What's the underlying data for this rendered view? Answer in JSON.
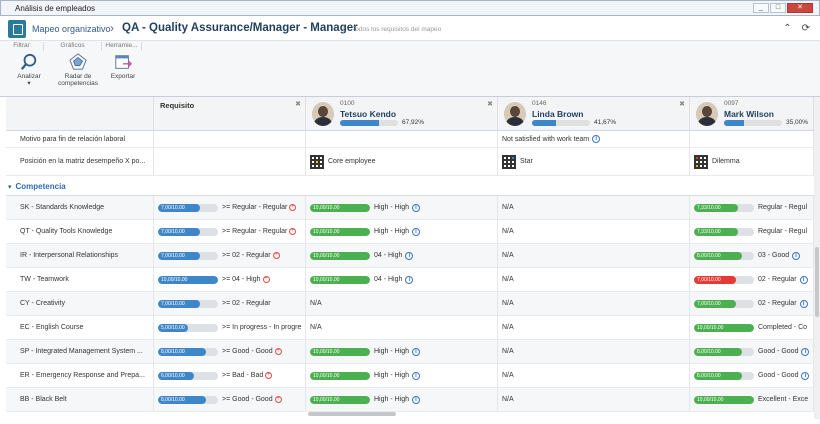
{
  "window": {
    "title": "Análisis de empleados",
    "buttons": [
      "_",
      "□",
      "✕"
    ]
  },
  "header": {
    "breadcrumb_root": "Mapeo organizativo",
    "separator": "›",
    "title": "QA - Quality Assurance/Manager - Manager",
    "subtitle": "Todos los requisitos del mapeo"
  },
  "ribbon": {
    "tabs": [
      "Filtrar",
      "Gráficos",
      "Herramie..."
    ],
    "buttons": [
      {
        "label": "Analizar",
        "icon": "analyze-icon",
        "dropdown": "▾"
      },
      {
        "label": "Radar de competencias",
        "icon": "radar-icon"
      },
      {
        "label": "Exportar",
        "icon": "export-icon"
      }
    ]
  },
  "columns": {
    "requirement": "Requisito",
    "employees": [
      {
        "code": "0100",
        "name": "Tetsuo Kendo",
        "progress": 67.92,
        "pct_label": "67,92%"
      },
      {
        "code": "0146",
        "name": "Linda Brown",
        "progress": 41.67,
        "pct_label": "41,67%"
      },
      {
        "code": "0097",
        "name": "Mark Wilson",
        "progress": 35.0,
        "pct_label": "35,00%"
      }
    ]
  },
  "info_rows": [
    {
      "label": "Motivo para fin de relación laboral",
      "values": [
        "",
        "Not satisfied with work team",
        ""
      ]
    },
    {
      "label": "Posición en la matriz desempeño X po...",
      "values": [
        "Core employee",
        "Star",
        "Dilemma"
      ]
    }
  ],
  "section": {
    "label": "Competencia",
    "caret": "▾"
  },
  "competencies": [
    {
      "label": "SK - Standards Knowledge",
      "req": {
        "bar": "7,00/10,00",
        "fill": 0.7,
        "text": ">= Regular - Regular",
        "plus": true
      },
      "emps": [
        {
          "bar": "10,00/10,00",
          "fill": 1.0,
          "color": "#4caf50",
          "text": "High - High",
          "info": true
        },
        {
          "text": "N/A"
        },
        {
          "bar": "7,33/10,00",
          "fill": 0.733,
          "color": "#4caf50",
          "text": "Regular - Regul"
        }
      ]
    },
    {
      "label": "QT - Quality Tools Knowledge",
      "req": {
        "bar": "7,00/10,00",
        "fill": 0.7,
        "text": ">= Regular - Regular",
        "plus": true
      },
      "emps": [
        {
          "bar": "10,00/10,00",
          "fill": 1.0,
          "color": "#4caf50",
          "text": "High - High",
          "info": true
        },
        {
          "text": "N/A"
        },
        {
          "bar": "7,33/10,00",
          "fill": 0.733,
          "color": "#4caf50",
          "text": "Regular - Regul"
        }
      ]
    },
    {
      "label": "IR - Interpersonal Relationships",
      "req": {
        "bar": "7,00/10,00",
        "fill": 0.7,
        "text": ">= 02 - Regular",
        "plus": true
      },
      "emps": [
        {
          "bar": "10,00/10,00",
          "fill": 1.0,
          "color": "#4caf50",
          "text": "04 - High",
          "info": true
        },
        {
          "text": "N/A"
        },
        {
          "bar": "8,00/10,00",
          "fill": 0.8,
          "color": "#4caf50",
          "text": "03 - Good",
          "info": true
        }
      ]
    },
    {
      "label": "TW - Teamwork",
      "req": {
        "bar": "10,00/10,00",
        "fill": 1.0,
        "text": ">= 04 - High",
        "plus": true
      },
      "emps": [
        {
          "bar": "10,00/10,00",
          "fill": 1.0,
          "color": "#4caf50",
          "text": "04 - High",
          "info": true
        },
        {
          "text": "N/A"
        },
        {
          "bar": "7,00/10,00",
          "fill": 0.7,
          "color": "#e53935",
          "text": "02 - Regular",
          "info": true
        }
      ]
    },
    {
      "label": "CY - Creativity",
      "req": {
        "bar": "7,00/10,00",
        "fill": 0.7,
        "text": ">= 02 - Regular",
        "plus": false
      },
      "emps": [
        {
          "text": "N/A"
        },
        {
          "text": "N/A"
        },
        {
          "bar": "7,00/10,00",
          "fill": 0.7,
          "color": "#4caf50",
          "text": "02 - Regular",
          "info": true
        }
      ]
    },
    {
      "label": "EC - English Course",
      "req": {
        "bar": "5,00/10,00",
        "fill": 0.5,
        "text": ">= In progress - In progre",
        "plus": false
      },
      "emps": [
        {
          "text": "N/A"
        },
        {
          "text": "N/A"
        },
        {
          "bar": "10,00/10,00",
          "fill": 1.0,
          "color": "#4caf50",
          "text": "Completed - Co"
        }
      ]
    },
    {
      "label": "SP - Integrated Management System ...",
      "req": {
        "bar": "8,00/10,00",
        "fill": 0.8,
        "text": ">= Good - Good",
        "plus": true
      },
      "emps": [
        {
          "bar": "10,00/10,00",
          "fill": 1.0,
          "color": "#4caf50",
          "text": "High - High",
          "info": true
        },
        {
          "text": "N/A"
        },
        {
          "bar": "8,00/10,00",
          "fill": 0.8,
          "color": "#4caf50",
          "text": "Good - Good",
          "info": true
        }
      ]
    },
    {
      "label": "ER - Emergency Response and Prepa...",
      "req": {
        "bar": "6,00/10,00",
        "fill": 0.6,
        "text": ">= Bad - Bad",
        "plus": true
      },
      "emps": [
        {
          "bar": "10,00/10,00",
          "fill": 1.0,
          "color": "#4caf50",
          "text": "High - High",
          "info": true
        },
        {
          "text": "N/A"
        },
        {
          "bar": "8,00/10,00",
          "fill": 0.8,
          "color": "#4caf50",
          "text": "Good - Good",
          "info": true
        }
      ]
    },
    {
      "label": "BB - Black Belt",
      "req": {
        "bar": "8,00/10,00",
        "fill": 0.8,
        "text": ">= Good - Good",
        "plus": true
      },
      "emps": [
        {
          "bar": "10,00/10,00",
          "fill": 1.0,
          "color": "#4caf50",
          "text": "High - High",
          "info": true
        },
        {
          "text": "N/A"
        },
        {
          "bar": "10,00/10,00",
          "fill": 1.0,
          "color": "#4caf50",
          "text": "Excellent - Exce"
        }
      ]
    }
  ],
  "colors": {
    "req_bar": "#3f86c9",
    "green": "#4caf50",
    "red": "#e53935",
    "accent": "#2e6db3"
  }
}
